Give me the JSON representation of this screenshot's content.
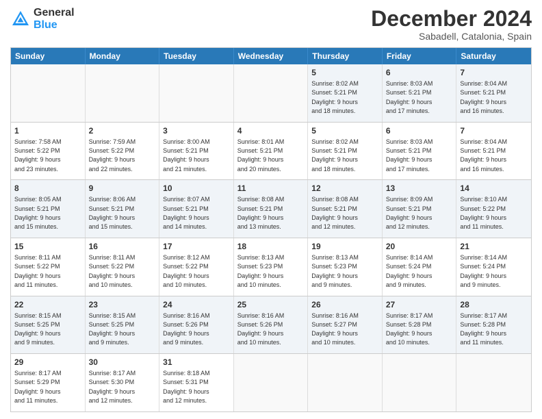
{
  "logo": {
    "general": "General",
    "blue": "Blue"
  },
  "title": "December 2024",
  "location": "Sabadell, Catalonia, Spain",
  "calendar": {
    "headers": [
      "Sunday",
      "Monday",
      "Tuesday",
      "Wednesday",
      "Thursday",
      "Friday",
      "Saturday"
    ],
    "weeks": [
      [
        {
          "day": "",
          "empty": true
        },
        {
          "day": "",
          "empty": true
        },
        {
          "day": "",
          "empty": true
        },
        {
          "day": "",
          "empty": true
        },
        {
          "day": "5",
          "lines": [
            "Sunrise: 8:02 AM",
            "Sunset: 5:21 PM",
            "Daylight: 9 hours",
            "and 18 minutes."
          ]
        },
        {
          "day": "6",
          "lines": [
            "Sunrise: 8:03 AM",
            "Sunset: 5:21 PM",
            "Daylight: 9 hours",
            "and 17 minutes."
          ]
        },
        {
          "day": "7",
          "lines": [
            "Sunrise: 8:04 AM",
            "Sunset: 5:21 PM",
            "Daylight: 9 hours",
            "and 16 minutes."
          ]
        }
      ],
      [
        {
          "day": "1",
          "lines": [
            "Sunrise: 7:58 AM",
            "Sunset: 5:22 PM",
            "Daylight: 9 hours",
            "and 23 minutes."
          ]
        },
        {
          "day": "2",
          "lines": [
            "Sunrise: 7:59 AM",
            "Sunset: 5:22 PM",
            "Daylight: 9 hours",
            "and 22 minutes."
          ]
        },
        {
          "day": "3",
          "lines": [
            "Sunrise: 8:00 AM",
            "Sunset: 5:21 PM",
            "Daylight: 9 hours",
            "and 21 minutes."
          ]
        },
        {
          "day": "4",
          "lines": [
            "Sunrise: 8:01 AM",
            "Sunset: 5:21 PM",
            "Daylight: 9 hours",
            "and 20 minutes."
          ]
        },
        {
          "day": "5",
          "lines": [
            "Sunrise: 8:02 AM",
            "Sunset: 5:21 PM",
            "Daylight: 9 hours",
            "and 18 minutes."
          ]
        },
        {
          "day": "6",
          "lines": [
            "Sunrise: 8:03 AM",
            "Sunset: 5:21 PM",
            "Daylight: 9 hours",
            "and 17 minutes."
          ]
        },
        {
          "day": "7",
          "lines": [
            "Sunrise: 8:04 AM",
            "Sunset: 5:21 PM",
            "Daylight: 9 hours",
            "and 16 minutes."
          ]
        }
      ],
      [
        {
          "day": "8",
          "lines": [
            "Sunrise: 8:05 AM",
            "Sunset: 5:21 PM",
            "Daylight: 9 hours",
            "and 15 minutes."
          ]
        },
        {
          "day": "9",
          "lines": [
            "Sunrise: 8:06 AM",
            "Sunset: 5:21 PM",
            "Daylight: 9 hours",
            "and 15 minutes."
          ]
        },
        {
          "day": "10",
          "lines": [
            "Sunrise: 8:07 AM",
            "Sunset: 5:21 PM",
            "Daylight: 9 hours",
            "and 14 minutes."
          ]
        },
        {
          "day": "11",
          "lines": [
            "Sunrise: 8:08 AM",
            "Sunset: 5:21 PM",
            "Daylight: 9 hours",
            "and 13 minutes."
          ]
        },
        {
          "day": "12",
          "lines": [
            "Sunrise: 8:08 AM",
            "Sunset: 5:21 PM",
            "Daylight: 9 hours",
            "and 12 minutes."
          ]
        },
        {
          "day": "13",
          "lines": [
            "Sunrise: 8:09 AM",
            "Sunset: 5:21 PM",
            "Daylight: 9 hours",
            "and 12 minutes."
          ]
        },
        {
          "day": "14",
          "lines": [
            "Sunrise: 8:10 AM",
            "Sunset: 5:22 PM",
            "Daylight: 9 hours",
            "and 11 minutes."
          ]
        }
      ],
      [
        {
          "day": "15",
          "lines": [
            "Sunrise: 8:11 AM",
            "Sunset: 5:22 PM",
            "Daylight: 9 hours",
            "and 11 minutes."
          ]
        },
        {
          "day": "16",
          "lines": [
            "Sunrise: 8:11 AM",
            "Sunset: 5:22 PM",
            "Daylight: 9 hours",
            "and 10 minutes."
          ]
        },
        {
          "day": "17",
          "lines": [
            "Sunrise: 8:12 AM",
            "Sunset: 5:22 PM",
            "Daylight: 9 hours",
            "and 10 minutes."
          ]
        },
        {
          "day": "18",
          "lines": [
            "Sunrise: 8:13 AM",
            "Sunset: 5:23 PM",
            "Daylight: 9 hours",
            "and 10 minutes."
          ]
        },
        {
          "day": "19",
          "lines": [
            "Sunrise: 8:13 AM",
            "Sunset: 5:23 PM",
            "Daylight: 9 hours",
            "and 9 minutes."
          ]
        },
        {
          "day": "20",
          "lines": [
            "Sunrise: 8:14 AM",
            "Sunset: 5:24 PM",
            "Daylight: 9 hours",
            "and 9 minutes."
          ]
        },
        {
          "day": "21",
          "lines": [
            "Sunrise: 8:14 AM",
            "Sunset: 5:24 PM",
            "Daylight: 9 hours",
            "and 9 minutes."
          ]
        }
      ],
      [
        {
          "day": "22",
          "lines": [
            "Sunrise: 8:15 AM",
            "Sunset: 5:25 PM",
            "Daylight: 9 hours",
            "and 9 minutes."
          ]
        },
        {
          "day": "23",
          "lines": [
            "Sunrise: 8:15 AM",
            "Sunset: 5:25 PM",
            "Daylight: 9 hours",
            "and 9 minutes."
          ]
        },
        {
          "day": "24",
          "lines": [
            "Sunrise: 8:16 AM",
            "Sunset: 5:26 PM",
            "Daylight: 9 hours",
            "and 9 minutes."
          ]
        },
        {
          "day": "25",
          "lines": [
            "Sunrise: 8:16 AM",
            "Sunset: 5:26 PM",
            "Daylight: 9 hours",
            "and 10 minutes."
          ]
        },
        {
          "day": "26",
          "lines": [
            "Sunrise: 8:16 AM",
            "Sunset: 5:27 PM",
            "Daylight: 9 hours",
            "and 10 minutes."
          ]
        },
        {
          "day": "27",
          "lines": [
            "Sunrise: 8:17 AM",
            "Sunset: 5:28 PM",
            "Daylight: 9 hours",
            "and 10 minutes."
          ]
        },
        {
          "day": "28",
          "lines": [
            "Sunrise: 8:17 AM",
            "Sunset: 5:28 PM",
            "Daylight: 9 hours",
            "and 11 minutes."
          ]
        }
      ],
      [
        {
          "day": "29",
          "lines": [
            "Sunrise: 8:17 AM",
            "Sunset: 5:29 PM",
            "Daylight: 9 hours",
            "and 11 minutes."
          ]
        },
        {
          "day": "30",
          "lines": [
            "Sunrise: 8:17 AM",
            "Sunset: 5:30 PM",
            "Daylight: 9 hours",
            "and 12 minutes."
          ]
        },
        {
          "day": "31",
          "lines": [
            "Sunrise: 8:18 AM",
            "Sunset: 5:31 PM",
            "Daylight: 9 hours",
            "and 12 minutes."
          ]
        },
        {
          "day": "",
          "empty": true
        },
        {
          "day": "",
          "empty": true
        },
        {
          "day": "",
          "empty": true
        },
        {
          "day": "",
          "empty": true
        }
      ]
    ]
  }
}
